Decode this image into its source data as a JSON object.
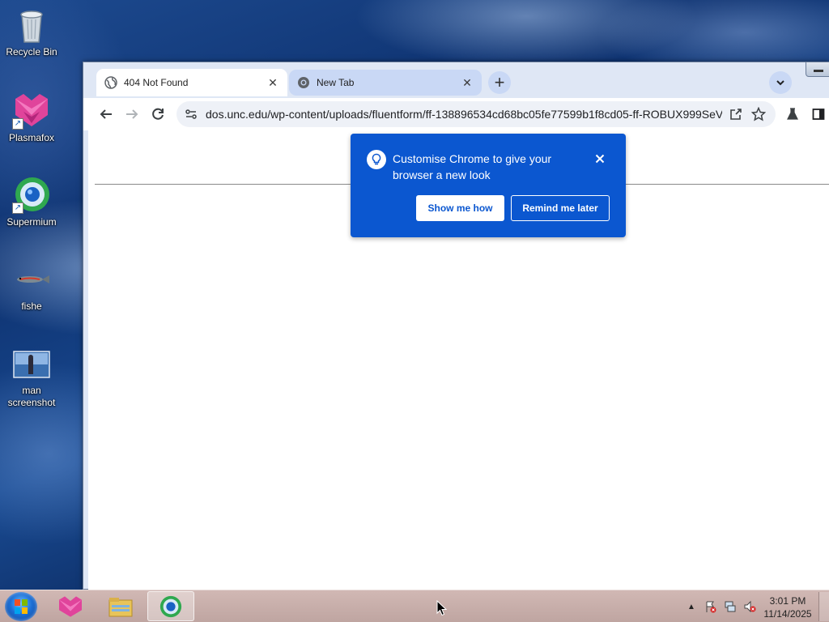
{
  "desktop": {
    "icons": [
      {
        "label": "Recycle Bin",
        "icon": "recycle-bin-icon"
      },
      {
        "label": "Plasmafox",
        "icon": "plasmafox-icon"
      },
      {
        "label": "Supermium",
        "icon": "supermium-icon"
      },
      {
        "label": "fishe",
        "icon": "fish-icon"
      },
      {
        "label": "man screenshot",
        "icon": "image-icon"
      }
    ]
  },
  "browser": {
    "tabs": [
      {
        "title": "404 Not Found",
        "icon": "globe-icon",
        "active": true
      },
      {
        "title": "New Tab",
        "icon": "chrome-icon",
        "active": false
      }
    ],
    "new_tab_symbol": "+",
    "url": "dos.unc.edu/wp-content/uploads/fluentform/ff-138896534cd68bc05fe77599b1f8cd05-ff-ROBUX999SeV..."
  },
  "popup": {
    "message": "Customise Chrome to give your browser a new look",
    "show_button": "Show me how",
    "later_button": "Remind me later"
  },
  "taskbar": {
    "time": "3:01 PM",
    "date": "11/14/2025",
    "tray_arrow": "▲"
  },
  "colors": {
    "popup_bg": "#0b57d0",
    "tab_strip": "#dfe7f5",
    "taskbar": "#c9afab"
  }
}
